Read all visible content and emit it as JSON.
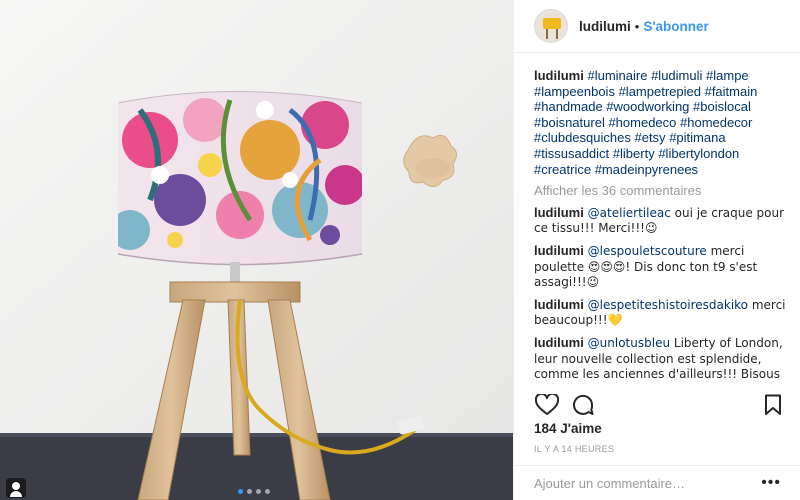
{
  "header": {
    "username": "ludilumi",
    "separator": "•",
    "follow_label": "S'abonner"
  },
  "caption": {
    "username": "ludilumi",
    "hashtags": [
      "#luminaire",
      "#ludimuli",
      "#lampe",
      "#lampeenbois",
      "#lampetrepied",
      "#faitmain",
      "#handmade",
      "#woodworking",
      "#boislocal",
      "#boisnaturel",
      "#homedeco",
      "#homedecor",
      "#clubdesquiches",
      "#etsy",
      "#pitimana",
      "#tissusaddict",
      "#liberty",
      "#libertylondon",
      "#creatrice",
      "#madeinpyrenees"
    ]
  },
  "view_all_comments": "Afficher les 36 commentaires",
  "comments": [
    {
      "username": "ludilumi",
      "mention": "@ateliertileac",
      "text": " oui je craque pour ce tissu!!! Merci!!!😉"
    },
    {
      "username": "ludilumi",
      "mention": "@lespouletscouture",
      "text": " merci poulette 😍😍😍! Dis donc ton t9 s'est assagi!!!😉"
    },
    {
      "username": "ludilumi",
      "mention": "@lespetiteshistoiresdakiko",
      "text": " merci beaucoup!!!💛"
    },
    {
      "username": "ludilumi",
      "mention": "@unlotusbleu",
      "text": " Liberty of London, leur nouvelle collection est splendide, comme les anciennes d'ailleurs!!! Bisous Coâme🙂"
    }
  ],
  "likes": "184 J'aime",
  "timestamp": "IL Y A 14 HEURES",
  "add_comment": {
    "placeholder": "Ajouter un commentaire…",
    "more_icon": "•••"
  },
  "icons": {
    "like": "heart-icon",
    "comment": "speech-bubble-icon",
    "save": "bookmark-icon",
    "more": "ellipsis-icon",
    "photo_tag": "user-tag-icon"
  },
  "colors": {
    "accent": "#3897f0",
    "hashtag": "#003569",
    "muted": "#999999",
    "text": "#262626"
  },
  "carousel": {
    "count": 4,
    "active": 1
  }
}
